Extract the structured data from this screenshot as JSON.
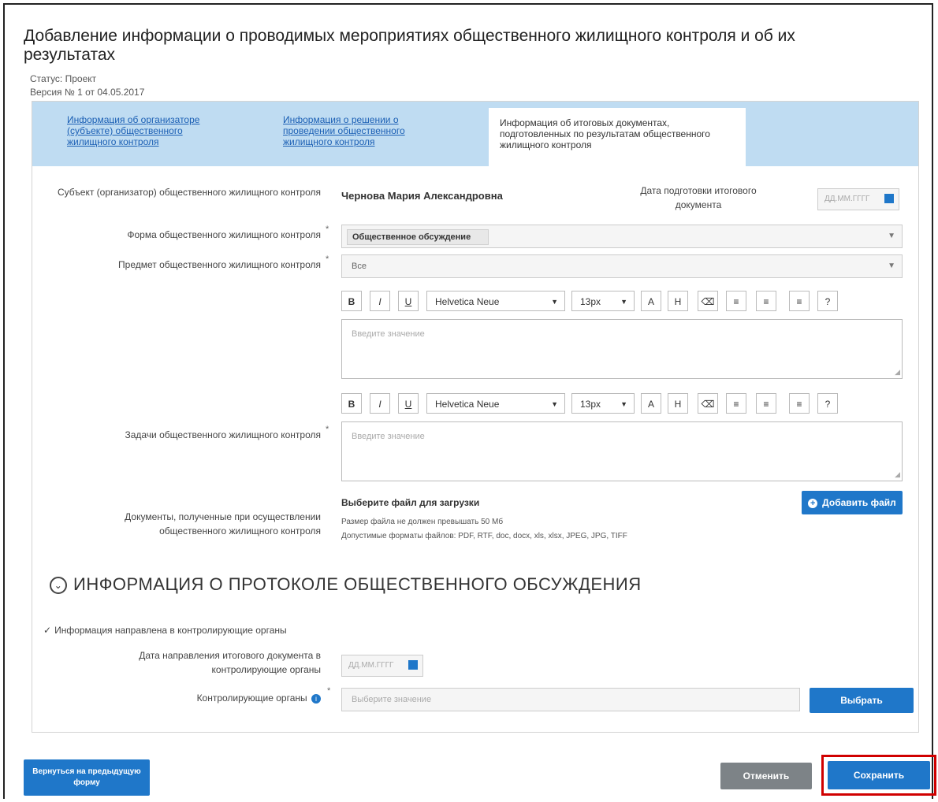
{
  "page": {
    "title": "Добавление информации о проводимых мероприятиях общественного жилищного контроля и об их результатах",
    "status": "Статус: Проект",
    "version": "Версия № 1 от 04.05.2017"
  },
  "tabs": [
    {
      "label": "Информация об организаторе (субъекте) общественного жилищного контроля"
    },
    {
      "label": "Информация о решении о проведении общественного жилищного контроля"
    },
    {
      "label": "Информация об итоговых документах, подготовленных по результатам общественного жилищного контроля"
    }
  ],
  "form": {
    "subject_label": "Субъект (организатор) общественного жилищного контроля",
    "subject_value": "Чернова Мария Александровна",
    "date_label": "Дата подготовки итогового документа",
    "date_placeholder": "ДД.ММ.ГГГГ",
    "form_label": "Форма общественного жилищного контроля",
    "form_value": "Общественное обсуждение",
    "subject_matter_label": "Предмет общественного жилищного контроля",
    "subject_matter_value": "Все",
    "tasks_label": "Задачи общественного жилищного контроля",
    "editor_placeholder": "Введите значение",
    "docs_label": "Документы, полученные при осуществлении общественного жилищного контроля",
    "file_choose": "Выберите файл для загрузки",
    "file_size_note": "Размер файла не должен превышать 50 Мб",
    "file_types_note": "Допустимые форматы файлов: PDF, RTF, doc, docx, xls, xlsx, JPEG, JPG, TIFF",
    "add_file_button": "Добавить файл",
    "required_mark": "*"
  },
  "toolbar": {
    "bold": "B",
    "italic": "I",
    "underline": "U",
    "font": "Helvetica Neue",
    "size": "13px",
    "color": "A",
    "highlight": "H",
    "eraser": "⌫",
    "list_ul": "≡",
    "list_ol": "≡",
    "align": "≡",
    "help": "?"
  },
  "protocol": {
    "section_title": "ИНФОРМАЦИЯ О ПРОТОКОЛЕ ОБЩЕСТВЕННОГО ОБСУЖДЕНИЯ",
    "checkbox_label": "Информация направлена в контролирующие органы",
    "send_date_label": "Дата направления итогового документа в контролирующие органы",
    "send_date_placeholder": "ДД.ММ.ГГГГ",
    "control_bodies_label": "Контролирующие органы",
    "control_bodies_placeholder": "Выберите значение",
    "choose_button": "Выбрать"
  },
  "footer": {
    "prev_button": "Вернуться на предыдущую форму",
    "cancel_button": "Отменить",
    "save_button": "Сохранить"
  },
  "colors": {
    "accent": "#1f77c9",
    "tabbar": "#bfdcf2",
    "highlight_border": "#d00000",
    "cancel": "#7d8387"
  }
}
